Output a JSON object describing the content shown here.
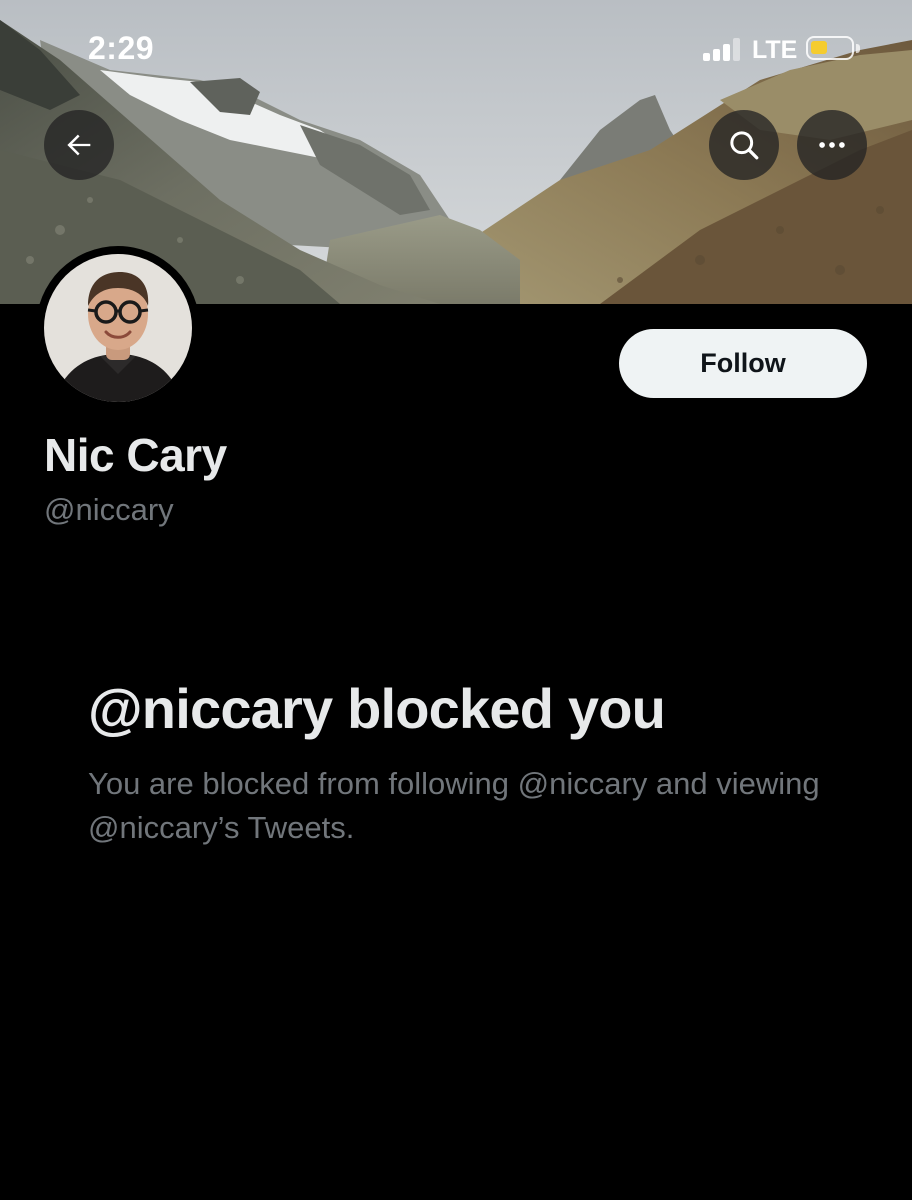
{
  "status_bar": {
    "time": "2:29",
    "network": "LTE",
    "battery_color": "#f5cc2f"
  },
  "header": {
    "back_icon": "arrow-left-icon",
    "search_icon": "search-icon",
    "more_icon": "more-horizontal-icon"
  },
  "profile": {
    "display_name": "Nic Cary",
    "handle": "@niccary",
    "follow_label": "Follow"
  },
  "blocked_notice": {
    "title": "@niccary blocked you",
    "description": "You are blocked from following @niccary and viewing @niccary’s Tweets."
  },
  "colors": {
    "background": "#000000",
    "primary_text": "#e7e9ea",
    "secondary_text": "#71767b",
    "follow_button_bg": "#eff3f4",
    "follow_button_text": "#0f1419"
  }
}
